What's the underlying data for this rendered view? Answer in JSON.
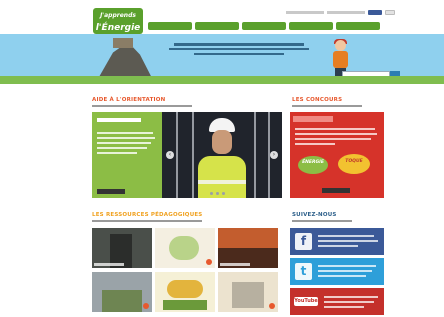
{
  "header": {
    "logo": {
      "line1": "J'apprends",
      "line2": "l'Énergie"
    },
    "nav_count": 5
  },
  "colors": {
    "brand_green": "#5aa02c",
    "orientation_card": "#8cbd45",
    "concours_card": "#d6332a",
    "heading_orange": "#e7592e",
    "heading_ressources": "#f0a11f",
    "facebook": "#3b5998",
    "twitter": "#2e9fd9",
    "youtube": "#c4302b"
  },
  "orientation": {
    "title": "AIDE À L'ORIENTATION"
  },
  "concours": {
    "title": "LES CONCOURS",
    "pill_1": "ÉNERGIE",
    "pill_2": "TOQUE"
  },
  "ressources": {
    "title": "LES RESSOURCES PÉDAGOGIQUES"
  },
  "social": {
    "title": "SUIVEZ-NOUS",
    "facebook_icon_glyph": "f",
    "twitter_icon_glyph": "t",
    "youtube_label": "YouTube"
  },
  "icons": {
    "slider_prev": "chevron-left-icon",
    "slider_next": "chevron-right-icon"
  }
}
